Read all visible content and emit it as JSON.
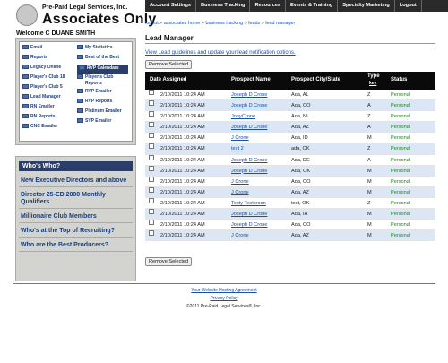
{
  "brand": {
    "line1": "Pre-Paid Legal Services, Inc.",
    "line2": "Associates Only"
  },
  "topnav": [
    "Account Settings",
    "Business Tracking",
    "Resources",
    "Events & Training",
    "Specialty Marketing",
    "Logout"
  ],
  "breadcrumb": {
    "items": [
      "logout",
      "associates home",
      "business tracking",
      "leads"
    ],
    "current": "lead manager",
    "sep": " > "
  },
  "welcome": "Welcome C DUANE SMITH",
  "menu": {
    "left": [
      "Email",
      "Reports",
      "Legacy Online",
      "Player's Club 18",
      "Player's Club 5",
      "Lead Manager",
      "RN Emailer",
      "RN Reports",
      "CNC Emailer"
    ],
    "right": [
      "My Statistics",
      "Best of the Best",
      "RVP Calendars",
      "Player's Club Reports",
      "RVP Emailer",
      "RVP Reports",
      "Platinum Emailer",
      "SVP Emailer"
    ],
    "active": "RVP Calendars"
  },
  "who": {
    "title": "Who's Who?",
    "items": [
      "New Executive Directors and above",
      "Director 25-ED 2000 Monthly Qualifiers",
      "Millionaire Club Members",
      "Who's at the Top of Recruiting?",
      "Who are the Best Producers?"
    ]
  },
  "page_title": "Lead Manager",
  "guide_link": "View Lead guidelines and update your lead notification options.",
  "remove_button": "Remove Selected",
  "table": {
    "headers": {
      "date": "Date Assigned",
      "name": "Prospect Name",
      "city": "Prospect City/State",
      "type": "Type",
      "type_sub": "key",
      "status": "Status"
    },
    "rows": [
      {
        "date": "2/10/2011 10:24 AM",
        "name": "Joseph D Crone",
        "city": "Ada, AL",
        "type": "Z",
        "status": "Personal"
      },
      {
        "date": "2/10/2011 10:24 AM",
        "name": "Joseph D Crone",
        "city": "Ada, CO",
        "type": "A",
        "status": "Personal"
      },
      {
        "date": "2/10/2011 10:24 AM",
        "name": "JoeyCrone",
        "city": "Ada, NL",
        "type": "Z",
        "status": "Personal"
      },
      {
        "date": "2/10/2011 10:24 AM",
        "name": "Joseph D Crone",
        "city": "Ada, AZ",
        "type": "A",
        "status": "Personal"
      },
      {
        "date": "2/10/2011 10:24 AM",
        "name": "J Crone",
        "city": "Ada, ID",
        "type": "M",
        "status": "Personal"
      },
      {
        "date": "2/10/2011 10:24 AM",
        "name": "test 2",
        "city": "ada, OK",
        "type": "Z",
        "status": "Personal"
      },
      {
        "date": "2/10/2011 10:24 AM",
        "name": "Joseph D Crone",
        "city": "Ada, DE",
        "type": "A",
        "status": "Personal"
      },
      {
        "date": "2/10/2011 10:24 AM",
        "name": "Joseph D Crone",
        "city": "Ada, OK",
        "type": "M",
        "status": "Personal"
      },
      {
        "date": "2/10/2011 10:24 AM",
        "name": "J Crone",
        "city": "Ada, CO",
        "type": "M",
        "status": "Personal"
      },
      {
        "date": "2/10/2011 10:24 AM",
        "name": "J Crone",
        "city": "Ada, AZ",
        "type": "M",
        "status": "Personal"
      },
      {
        "date": "2/10/2011 10:24 AM",
        "name": "Testy Testerson",
        "city": "test, OK",
        "type": "Z",
        "status": "Personal"
      },
      {
        "date": "2/10/2011 10:24 AM",
        "name": "Joseph D Crone",
        "city": "Ada, IA",
        "type": "M",
        "status": "Personal"
      },
      {
        "date": "2/10/2011 10:24 AM",
        "name": "Joseph D Crone",
        "city": "Ada, CO",
        "type": "M",
        "status": "Personal"
      },
      {
        "date": "2/10/2011 10:24 AM",
        "name": "J Crone",
        "city": "Ada, AZ",
        "type": "M",
        "status": "Personal"
      }
    ]
  },
  "footer": {
    "hosting": "Your Website Hosting Agreement",
    "privacy": "Privacy Policy",
    "copyright": "©2011 Pre-Paid Legal Services®, Inc."
  }
}
